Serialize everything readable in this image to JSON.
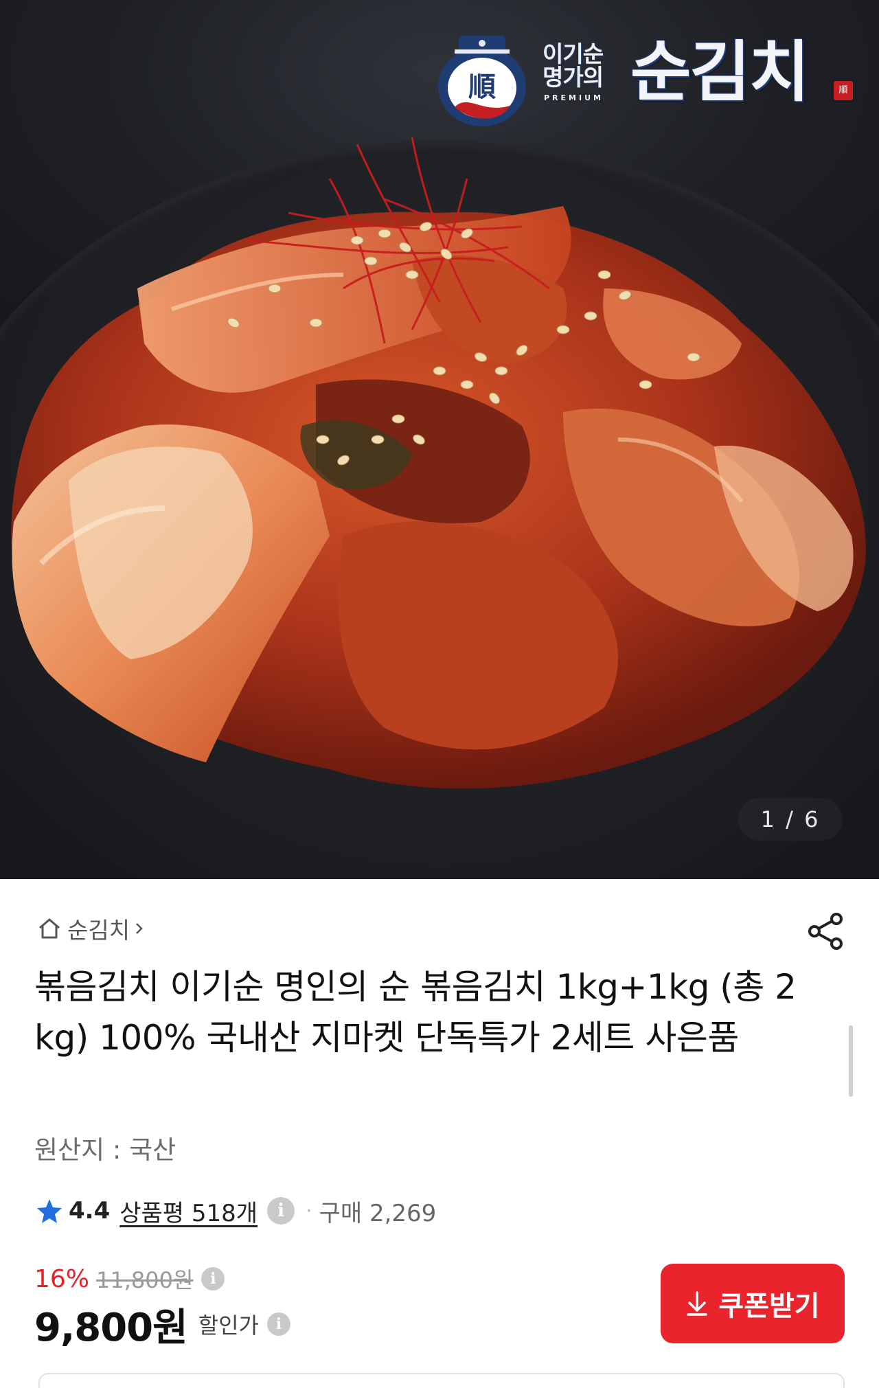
{
  "gallery": {
    "counter": "1 / 6",
    "logo": {
      "small_line1": "이기순",
      "small_line2": "명가의",
      "sub": "PREMIUM",
      "big": "순김치",
      "emblem_char": "順",
      "seal_char": "順"
    }
  },
  "breadcrumb": {
    "label": "순김치",
    "icon": "home-icon"
  },
  "share_icon": "share-icon",
  "product": {
    "title": "볶음김치 이기순 명인의 순 볶음김치 1kg+1kg (총 2kg) 100% 국내산 지마켓 단독특가 2세트 사은품",
    "origin": "원산지 : 국산",
    "rating": "4.4",
    "review_link": "상품평 518개",
    "purchase_count": "구매 2,269",
    "info_glyph": "i"
  },
  "price": {
    "discount": "16%",
    "original": "11,800원",
    "sale": "9,800원",
    "sale_label": "할인가"
  },
  "coupon_button": {
    "label": "쿠폰받기",
    "icon": "download-arrow-icon"
  },
  "colors": {
    "accent_red": "#e9242c",
    "discount_red": "#e8202a",
    "star_blue": "#1f6fe0",
    "logo_navy": "#1f3d73"
  }
}
